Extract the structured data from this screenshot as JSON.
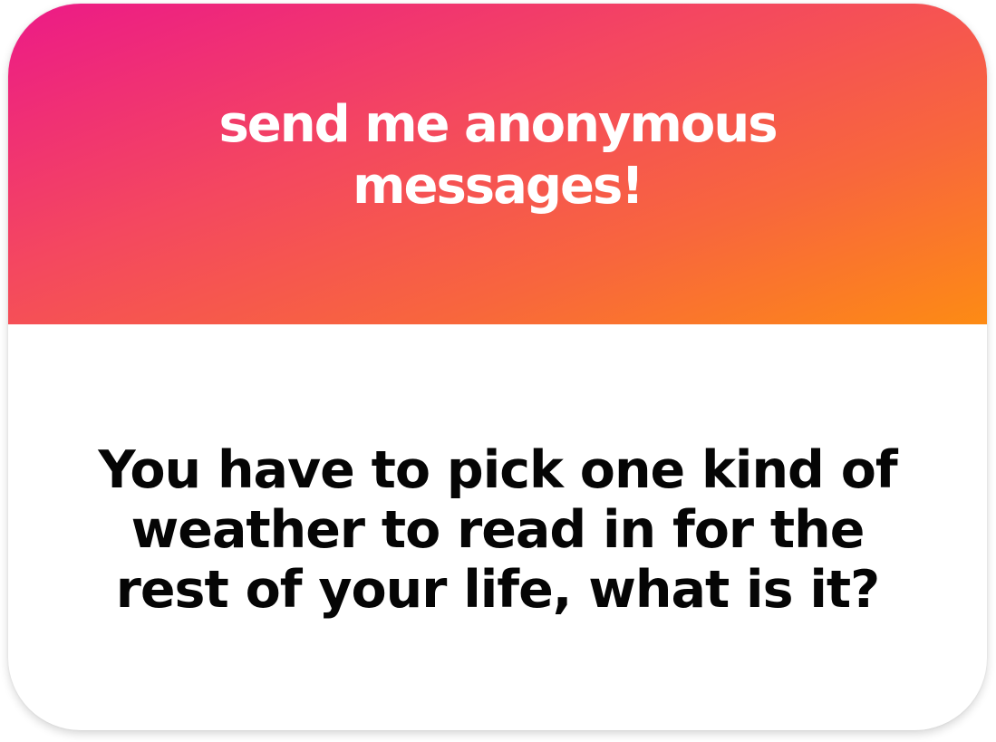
{
  "card": {
    "header_title": "send me anonymous messages!",
    "question": "You have to pick one kind of weather to read in for the rest of your life, what is it?"
  },
  "colors": {
    "gradient_start": "#ec1a87",
    "gradient_end": "#fd8b14",
    "header_text": "#ffffff",
    "question_text": "#050505",
    "card_background": "#ffffff"
  }
}
